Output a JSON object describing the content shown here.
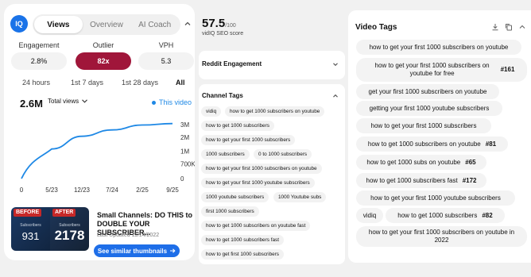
{
  "left": {
    "logo": "IQ",
    "tabs": [
      "Views",
      "Overview",
      "AI Coach"
    ],
    "metrics": [
      {
        "label": "Engagement",
        "value": "2.8%"
      },
      {
        "label": "Outlier",
        "value": "82x"
      },
      {
        "label": "VPH",
        "value": "5.3"
      }
    ],
    "ranges": [
      "24 hours",
      "1st 7 days",
      "1st 28 days",
      "All"
    ],
    "total": "2.6M",
    "select_label": "Total views",
    "legend": "This video"
  },
  "chart_data": {
    "type": "line",
    "x_ticks": [
      "0",
      "5/23",
      "12/23",
      "7/24",
      "2/25",
      "9/25"
    ],
    "y_ticks": [
      "0",
      "700K",
      "1M",
      "2M",
      "3M"
    ],
    "series": [
      {
        "name": "This video",
        "color": "#1e88e5",
        "x": [
          "0",
          "5/23",
          "12/23",
          "7/24",
          "2/25",
          "9/25"
        ],
        "y": [
          0,
          1400000,
          2000000,
          2300000,
          2530000,
          2600000
        ]
      }
    ]
  },
  "video": {
    "before_tag": "BEFORE",
    "after_tag": "AFTER",
    "subscribers_label": "Subscribers",
    "before_count": "931",
    "after_count": "2178",
    "title": "Small Channels: DO THIS to DOUBLE YOUR SUBSCRIBER...",
    "updated": "Last Updated 11/14/2022",
    "similar_button": "See similar thumbnails"
  },
  "middle": {
    "score": "57.5",
    "score_suffix": "/100",
    "score_label": "vidIQ SEO score",
    "reddit_title": "Reddit Engagement",
    "channel_tags_title": "Channel Tags",
    "channel_tags": [
      "vidiq",
      "how to get 1000 subscribers on youtube",
      "how to get 1000 subscribers",
      "how to get your first 1000 subscribers",
      "1000 subscribers",
      "0 to 1000 subscribers",
      "how to get your first 1000 subscribers on youtube",
      "how to get your first 1000 youtube subscribers",
      "1000 youtube subscribers",
      "1000 Youtube subs",
      "first 1000 subscribers",
      "how to get 1000 subscribers on youtube fast",
      "how to get 1000 subscribers fast",
      "how to get first 1000 subscribers"
    ]
  },
  "right": {
    "title": "Video Tags",
    "tags": [
      {
        "text": "how to get your first 1000 subscribers on youtube",
        "rank": ""
      },
      {
        "text": "how to get your first 1000 subscribers on youtube for free",
        "rank": "#161"
      },
      {
        "text": "get your first 1000 subscribers on youtube",
        "rank": ""
      },
      {
        "text": "getting your first 1000 youtube subscribers",
        "rank": ""
      },
      {
        "text": "how to get your first 1000 subscribers",
        "rank": ""
      },
      {
        "text": "how to get 1000 subscribers on youtube",
        "rank": "#81"
      },
      {
        "text": "how to get 1000 subs on youtube",
        "rank": "#65"
      },
      {
        "text": "how to get 1000 subscribers fast",
        "rank": "#172"
      },
      {
        "text": "how to get your first 1000 youtube subscribers",
        "rank": ""
      },
      {
        "text": "vidiq",
        "rank": ""
      },
      {
        "text": "how to get 1000 subscribers",
        "rank": "#82"
      },
      {
        "text": "how to get your first 1000 subscribers on youtube in 2022",
        "rank": ""
      }
    ]
  }
}
